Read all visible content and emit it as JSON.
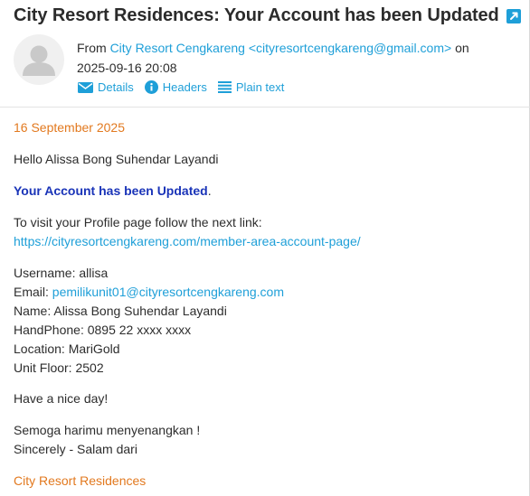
{
  "email": {
    "subject": "City Resort Residences: Your Account has been Updated",
    "from_prefix": "From",
    "sender_name": "City Resort Cengkareng <cityresortcengkareng@gmail.com>",
    "from_suffix": "on",
    "date_time": "2025-09-16 20:08",
    "actions": {
      "details": "Details",
      "headers": "Headers",
      "plain_text": "Plain text"
    }
  },
  "body": {
    "date": "16 September 2025",
    "greeting": "Hello Alissa Bong Suhendar Layandi",
    "headline": "Your Account has been Updated",
    "headline_period": ".",
    "visit_text": "To visit your Profile page follow the next link:",
    "profile_link": "https://cityresortcengkareng.com/member-area-account-page/",
    "username": "Username: allisa",
    "email_label": "Email:",
    "email_value": "pemilikunit01@cityresortcengkareng.com",
    "name": "Name: Alissa Bong Suhendar Layandi",
    "handphone": "HandPhone: 0895 22 xxxx xxxx",
    "location": "Location: MariGold",
    "unit_floor": "Unit Floor: 2502",
    "nice_day": "Have a nice day!",
    "semoga": "Semoga harimu menyenangkan !",
    "sincerely": "Sincerely - Salam dari",
    "signature": "City Resort Residences"
  },
  "colors": {
    "link": "#1e9fd8",
    "accent_orange": "#e2791f",
    "headline_blue": "#1a34b8"
  },
  "icons": {
    "open_external": "external-link-icon",
    "avatar": "user-avatar-icon",
    "details": "envelope-icon",
    "headers": "info-icon",
    "plain_text": "lines-icon"
  }
}
